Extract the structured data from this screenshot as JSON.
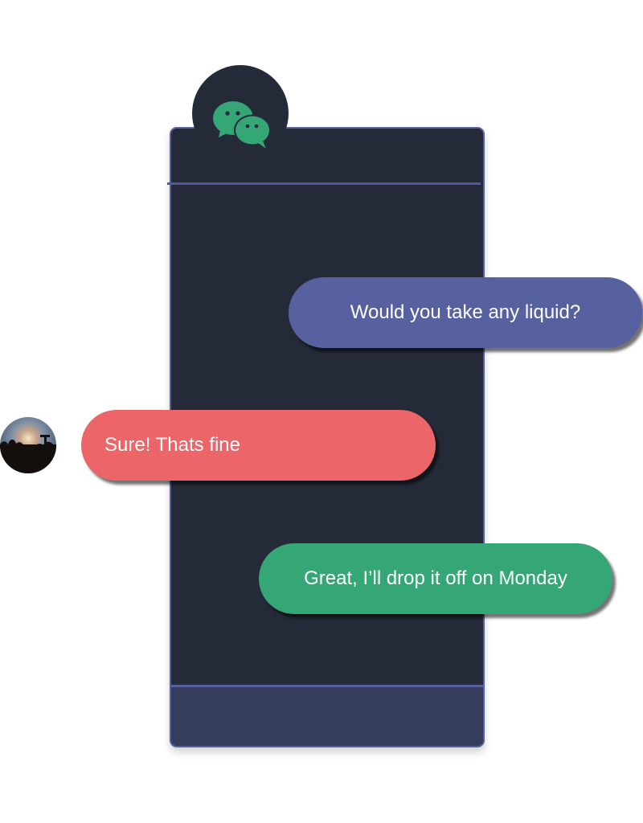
{
  "app": {
    "icon": "chat-bubbles-icon",
    "icon_color": "#35a676"
  },
  "messages": [
    {
      "sender": "outgoing",
      "text": "Would you take any liquid?",
      "color": "#5761a0"
    },
    {
      "sender": "incoming",
      "text": "Sure! Thats fine",
      "color": "#ec6568"
    },
    {
      "sender": "outgoing",
      "text": "Great, I’ll drop it off on Monday",
      "color": "#35a676"
    }
  ],
  "colors": {
    "phone_body": "#252a38",
    "phone_border": "#5861a0",
    "phone_footer": "#363c5c"
  }
}
